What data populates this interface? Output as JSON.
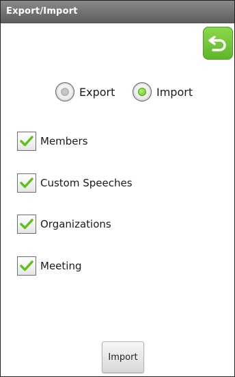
{
  "window": {
    "title": "Export/Import"
  },
  "toolbar": {
    "back_icon": "back-arrow-icon",
    "accent_color": "#6cc236"
  },
  "mode": {
    "options": [
      {
        "label": "Export",
        "selected": false
      },
      {
        "label": "Import",
        "selected": true
      }
    ]
  },
  "items": [
    {
      "label": "Members",
      "checked": true
    },
    {
      "label": "Custom Speeches",
      "checked": true
    },
    {
      "label": "Organizations",
      "checked": true
    },
    {
      "label": "Meeting",
      "checked": true
    }
  ],
  "actions": {
    "import_label": "Import"
  }
}
